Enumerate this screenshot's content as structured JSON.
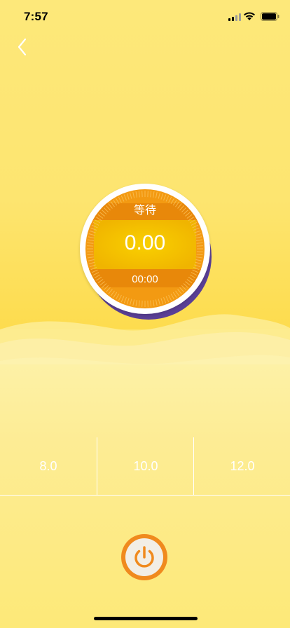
{
  "status_bar": {
    "time": "7:57"
  },
  "dial": {
    "status": "等待",
    "value": "0.00",
    "timer": "00:00"
  },
  "levels": [
    {
      "label": "8.0"
    },
    {
      "label": "10.0"
    },
    {
      "label": "12.0"
    }
  ],
  "colors": {
    "background": "#fde66d",
    "dial_outer": "#f39a12",
    "dial_band": "#e8880a",
    "dial_center": "#f5c400",
    "power_ring": "#f08a1e",
    "power_icon": "#f08a1e"
  },
  "icons": {
    "back": "chevron-left-icon",
    "power": "power-icon"
  }
}
